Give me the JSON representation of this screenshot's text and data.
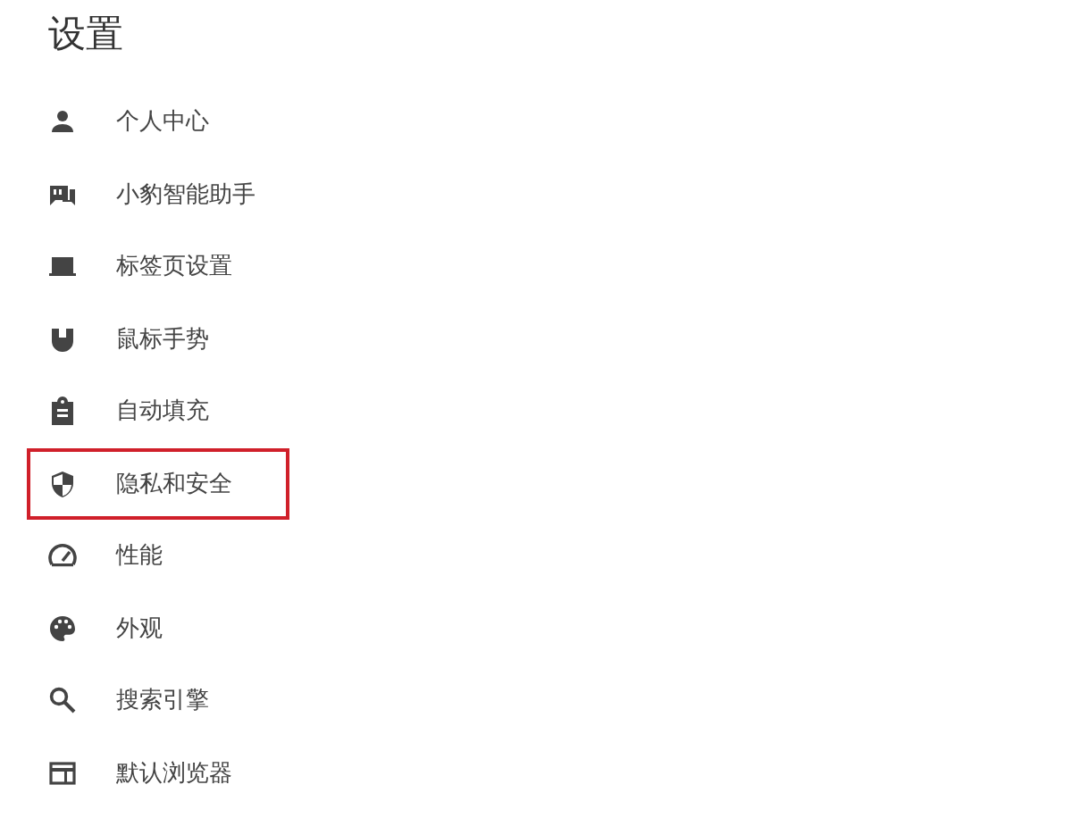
{
  "title": "设置",
  "items": [
    {
      "label": "个人中心",
      "highlighted": false
    },
    {
      "label": "小豹智能助手",
      "highlighted": false
    },
    {
      "label": "标签页设置",
      "highlighted": false
    },
    {
      "label": "鼠标手势",
      "highlighted": false
    },
    {
      "label": "自动填充",
      "highlighted": false
    },
    {
      "label": "隐私和安全",
      "highlighted": true
    },
    {
      "label": "性能",
      "highlighted": false
    },
    {
      "label": "外观",
      "highlighted": false
    },
    {
      "label": "搜索引擎",
      "highlighted": false
    },
    {
      "label": "默认浏览器",
      "highlighted": false
    }
  ]
}
